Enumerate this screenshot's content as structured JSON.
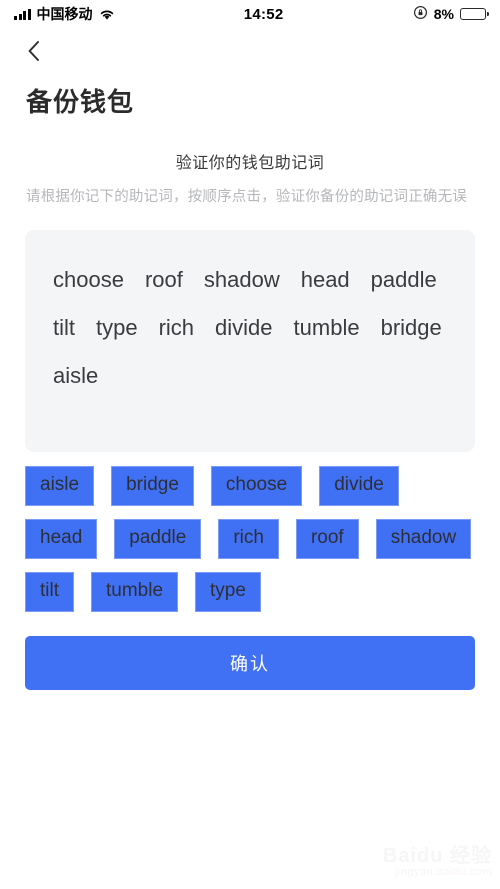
{
  "status_bar": {
    "carrier": "中国移动",
    "time": "14:52",
    "battery_percent": "8%",
    "battery_level": 8,
    "signal_icon": "signal-bars-icon",
    "wifi_icon": "wifi-icon",
    "rotation_lock_icon": "rotation-lock-icon",
    "battery_icon": "battery-icon",
    "battery_color": "#f03a27"
  },
  "nav": {
    "back_icon": "chevron-left-icon"
  },
  "page": {
    "title": "备份钱包"
  },
  "intro": {
    "heading": "验证你的钱包助记词",
    "description": "请根据你记下的助记词，按顺序点击，验证你备份的助记词正确无误"
  },
  "panel": {
    "selected_words": [
      "choose",
      "roof",
      "shadow",
      "head",
      "paddle",
      "tilt",
      "type",
      "rich",
      "divide",
      "tumble",
      "bridge",
      "aisle"
    ]
  },
  "word_bank": {
    "accent_color": "#4070f4",
    "chips": [
      "aisle",
      "bridge",
      "choose",
      "divide",
      "head",
      "paddle",
      "rich",
      "roof",
      "shadow",
      "tilt",
      "tumble",
      "type"
    ]
  },
  "actions": {
    "confirm_label": "确认"
  },
  "watermark": {
    "main": "Baidu 经验",
    "sub": "jingyan.baidu.com"
  }
}
